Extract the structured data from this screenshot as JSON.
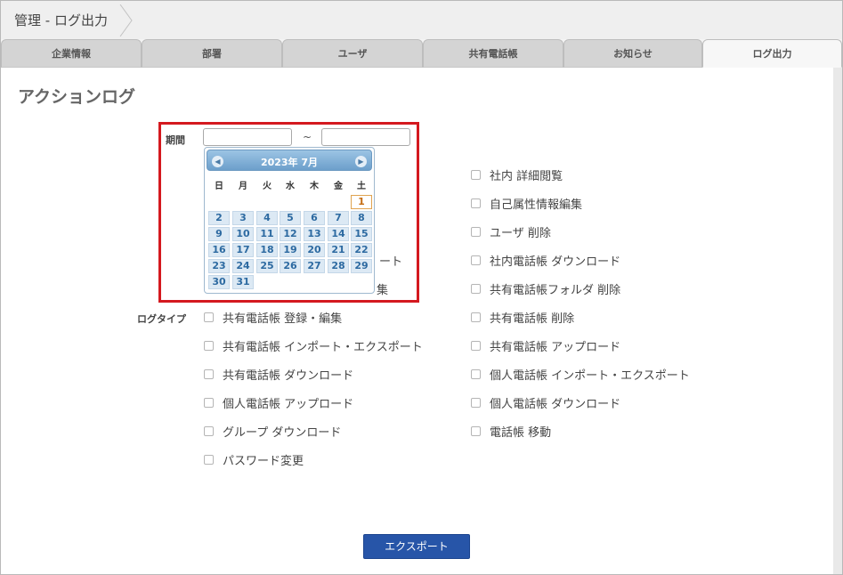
{
  "breadcrumb": {
    "title": "管理 - ログ出力"
  },
  "tabs": [
    {
      "label": "企業情報"
    },
    {
      "label": "部署"
    },
    {
      "label": "ユーザ"
    },
    {
      "label": "共有電話帳"
    },
    {
      "label": "お知らせ"
    },
    {
      "label": "ログ出力"
    }
  ],
  "page": {
    "heading": "アクションログ"
  },
  "form": {
    "period_label": "期間",
    "period_sep": "~",
    "logtype_label": "ログタイプ",
    "start_date": "",
    "end_date": ""
  },
  "calendar": {
    "title": "2023年 7月",
    "weekdays": [
      "日",
      "月",
      "火",
      "水",
      "木",
      "金",
      "土"
    ],
    "days": [
      "1",
      "2",
      "3",
      "4",
      "5",
      "6",
      "7",
      "8",
      "9",
      "10",
      "11",
      "12",
      "13",
      "14",
      "15",
      "16",
      "17",
      "18",
      "19",
      "20",
      "21",
      "22",
      "23",
      "24",
      "25",
      "26",
      "27",
      "28",
      "29",
      "30",
      "31"
    ],
    "first_weekday": 6,
    "today": "1"
  },
  "log_types_left": [
    {
      "label": "ート",
      "partial": true
    },
    {
      "label": "集",
      "partial": true
    },
    {
      "label": "共有電話帳 登録・編集"
    },
    {
      "label": "共有電話帳 インポート・エクスポート"
    },
    {
      "label": "共有電話帳 ダウンロード"
    },
    {
      "label": "個人電話帳 アップロード"
    },
    {
      "label": "グループ ダウンロード"
    },
    {
      "label": "パスワード変更"
    }
  ],
  "log_types_right": [
    {
      "label": "社内 詳細閲覧"
    },
    {
      "label": "自己属性情報編集"
    },
    {
      "label": "ユーザ 削除"
    },
    {
      "label": "社内電話帳 ダウンロード"
    },
    {
      "label": "共有電話帳フォルダ 削除"
    },
    {
      "label": "共有電話帳 削除"
    },
    {
      "label": "共有電話帳 アップロード"
    },
    {
      "label": "個人電話帳 インポート・エクスポート"
    },
    {
      "label": "個人電話帳 ダウンロード"
    },
    {
      "label": "電話帳 移動"
    }
  ],
  "actions": {
    "export_label": "エクスポート"
  }
}
